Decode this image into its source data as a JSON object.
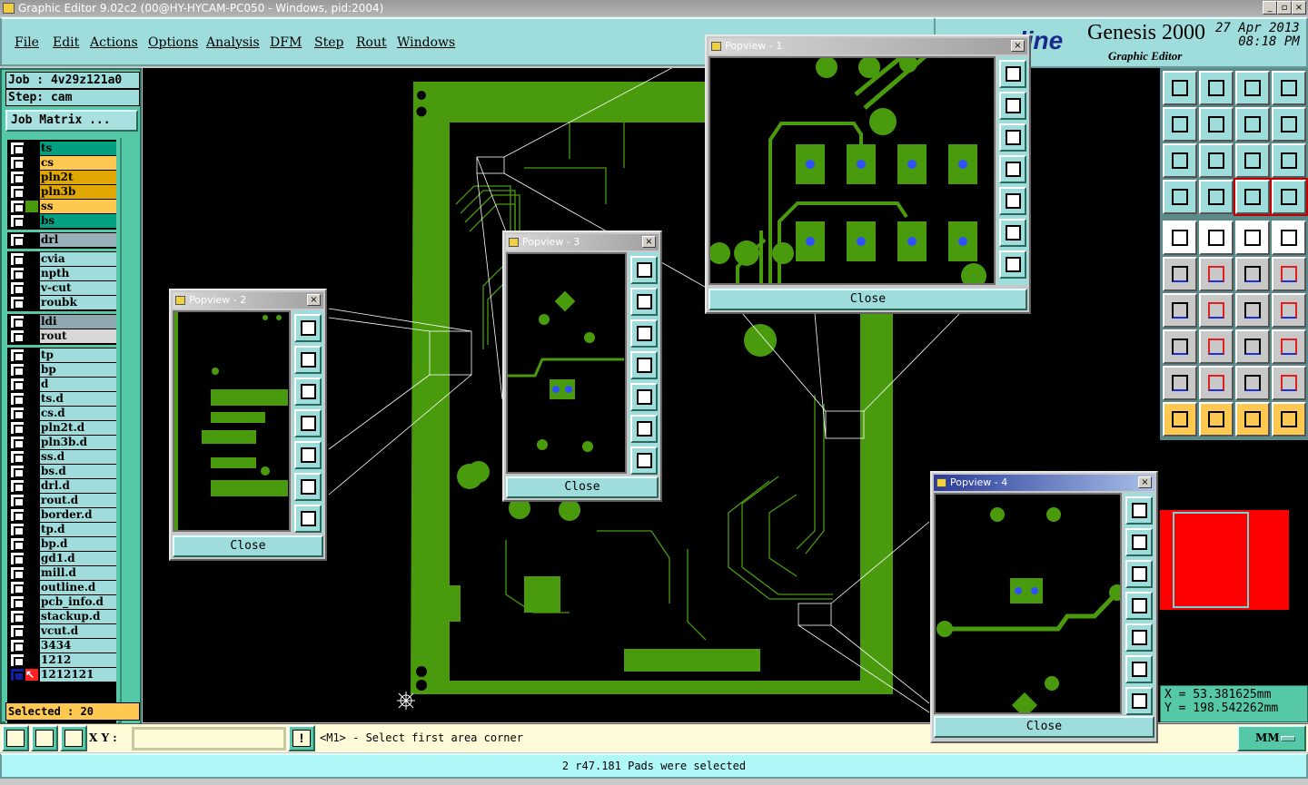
{
  "window": {
    "title": "Graphic Editor 9.02c2 (00@HY-HYCAM-PC050 - Windows, pid:2004)",
    "min": "_",
    "max": "▫",
    "close": "×"
  },
  "menu": [
    "File",
    "Edit",
    "Actions",
    "Options",
    "Analysis",
    "DFM",
    "Step",
    "Rout",
    "Windows"
  ],
  "logo": {
    "brand": "line",
    "product": "Genesis 2000",
    "subtitle": "Graphic Editor",
    "date": "27 Apr 2013",
    "time": "08:18 PM"
  },
  "job": {
    "job": "Job : 4v29z121a0",
    "step": "Step: cam",
    "matrix_button": "Job Matrix ..."
  },
  "layers": [
    {
      "name": "ts",
      "color": "#00a080",
      "group": 0
    },
    {
      "name": "cs",
      "color": "#ffc850",
      "group": 0
    },
    {
      "name": "pln2t",
      "color": "#e0a800",
      "group": 0
    },
    {
      "name": "pln3b",
      "color": "#e0a800",
      "group": 0
    },
    {
      "name": "ss",
      "color": "#ffc850",
      "group": 0,
      "active": true
    },
    {
      "name": "bs",
      "color": "#00a080",
      "group": 0
    },
    {
      "name": "drl",
      "color": "#98b0b8",
      "group": 1
    },
    {
      "name": "cvia",
      "color": "#a0dcdc",
      "group": 2
    },
    {
      "name": "npth",
      "color": "#a0dcdc",
      "group": 2
    },
    {
      "name": "v-cut",
      "color": "#a0dcdc",
      "group": 2
    },
    {
      "name": "roubk",
      "color": "#a0dcdc",
      "group": 2
    },
    {
      "name": "ldi",
      "color": "#90a8b0",
      "group": 3
    },
    {
      "name": "rout",
      "color": "#d8d8d8",
      "group": 3
    },
    {
      "name": "tp",
      "color": "#a0dcdc",
      "group": 4
    },
    {
      "name": "bp",
      "color": "#a0dcdc",
      "group": 4
    },
    {
      "name": "d",
      "color": "#a0dcdc",
      "group": 4
    },
    {
      "name": "ts.d",
      "color": "#a0dcdc",
      "group": 4
    },
    {
      "name": "cs.d",
      "color": "#a0dcdc",
      "group": 4
    },
    {
      "name": "pln2t.d",
      "color": "#a0dcdc",
      "group": 4
    },
    {
      "name": "pln3b.d",
      "color": "#a0dcdc",
      "group": 4
    },
    {
      "name": "ss.d",
      "color": "#a0dcdc",
      "group": 4
    },
    {
      "name": "bs.d",
      "color": "#a0dcdc",
      "group": 4
    },
    {
      "name": "drl.d",
      "color": "#a0dcdc",
      "group": 4
    },
    {
      "name": "rout.d",
      "color": "#a0dcdc",
      "group": 4
    },
    {
      "name": "border.d",
      "color": "#a0dcdc",
      "group": 4
    },
    {
      "name": "tp.d",
      "color": "#a0dcdc",
      "group": 4
    },
    {
      "name": "bp.d",
      "color": "#a0dcdc",
      "group": 4
    },
    {
      "name": "gd1.d",
      "color": "#a0dcdc",
      "group": 4
    },
    {
      "name": "mill.d",
      "color": "#a0dcdc",
      "group": 4
    },
    {
      "name": "outline.d",
      "color": "#a0dcdc",
      "group": 4
    },
    {
      "name": "pcb_info.d",
      "color": "#a0dcdc",
      "group": 4
    },
    {
      "name": "stackup.d",
      "color": "#a0dcdc",
      "group": 4
    },
    {
      "name": "vcut.d",
      "color": "#a0dcdc",
      "group": 4
    },
    {
      "name": "3434",
      "color": "#a0dcdc",
      "group": 4
    },
    {
      "name": "1212",
      "color": "#a0dcdc",
      "group": 4
    },
    {
      "name": "1212121",
      "color": "#a0dcdc",
      "group": 4,
      "work": true
    }
  ],
  "selected": "Selected : 20",
  "toolbar_icons": [
    "zoom-up-icon",
    "zoom-down-icon",
    "home-icon",
    "grid-xy-icon",
    "pan-left-icon",
    "pan-right-icon",
    "undo-view-icon",
    "snap-icon",
    "zoom-in-icon",
    "zoom-out-icon",
    "scale-1-2-icon",
    "query-icon",
    "tools-palette-icon",
    "grid-icon",
    "net-display-icon",
    "net-display-2-icon",
    "pad-move-icon",
    "select-window-icon",
    "ruler-icon",
    "pad-icon",
    "connect-icon",
    "delete-icon",
    "move-pad-icon",
    "move-pad-2-icon",
    "angle-line-icon",
    "line-icon",
    "rotate-icon",
    "mirror-icon",
    "resize-icon",
    "segment-icon",
    "spacing-icon",
    "overlap-icon",
    "triangle-icon",
    "arc-up-icon",
    "arc-icon",
    "arc-cut-icon",
    "select-icon",
    "select-box-icon",
    "select-poly-icon",
    "select-net-icon"
  ],
  "coords": {
    "x": "X  =  53.381625mm",
    "y": "Y  =  198.542262mm"
  },
  "bottom": {
    "xy_label": "X Y :",
    "xy_value": "",
    "prompt": "<M1> - Select first area corner",
    "units": "MM"
  },
  "status": "2 r47.181 Pads were selected",
  "popviews": [
    {
      "title": "Popview - 1",
      "close": "Close"
    },
    {
      "title": "Popview - 2",
      "close": "Close"
    },
    {
      "title": "Popview - 3",
      "close": "Close"
    },
    {
      "title": "Popview - 4",
      "close": "Close"
    }
  ],
  "colors": {
    "copper": "#4a9a0e",
    "pad_center": "#3050ff",
    "background": "#000000",
    "panel": "#9fdcdc"
  }
}
